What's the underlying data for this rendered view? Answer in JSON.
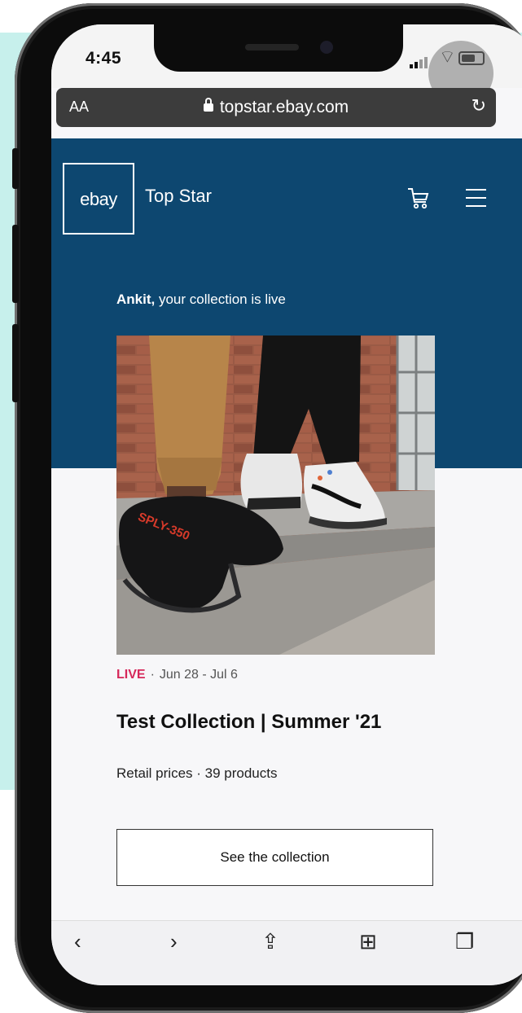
{
  "status_bar": {
    "time": "4:45"
  },
  "browser": {
    "text_size_label": "AA",
    "url": "topstar.ebay.com",
    "lock_icon": "lock-icon",
    "reload_icon": "reload-icon"
  },
  "site_header": {
    "logo_text": "ebay",
    "store_name": "Top Star",
    "cart_icon": "cart-icon",
    "menu_icon": "hamburger-menu-icon"
  },
  "main": {
    "greeting_name": "Ankit,",
    "greeting_text": " your collection is live",
    "status": "LIVE",
    "date_range": "Jun 28 - Jul 6",
    "title": "Test Collection | Summer '21",
    "meta": "Retail prices · 39 products",
    "cta_label": "See the collection"
  },
  "toolbar": {
    "icons": [
      "back-icon",
      "forward-icon",
      "share-icon",
      "bookmarks-icon",
      "tabs-icon"
    ]
  },
  "colors": {
    "header_bg": "#0d4770",
    "live_accent": "#d6285a",
    "backdrop_mint": "#c7f0ec"
  }
}
